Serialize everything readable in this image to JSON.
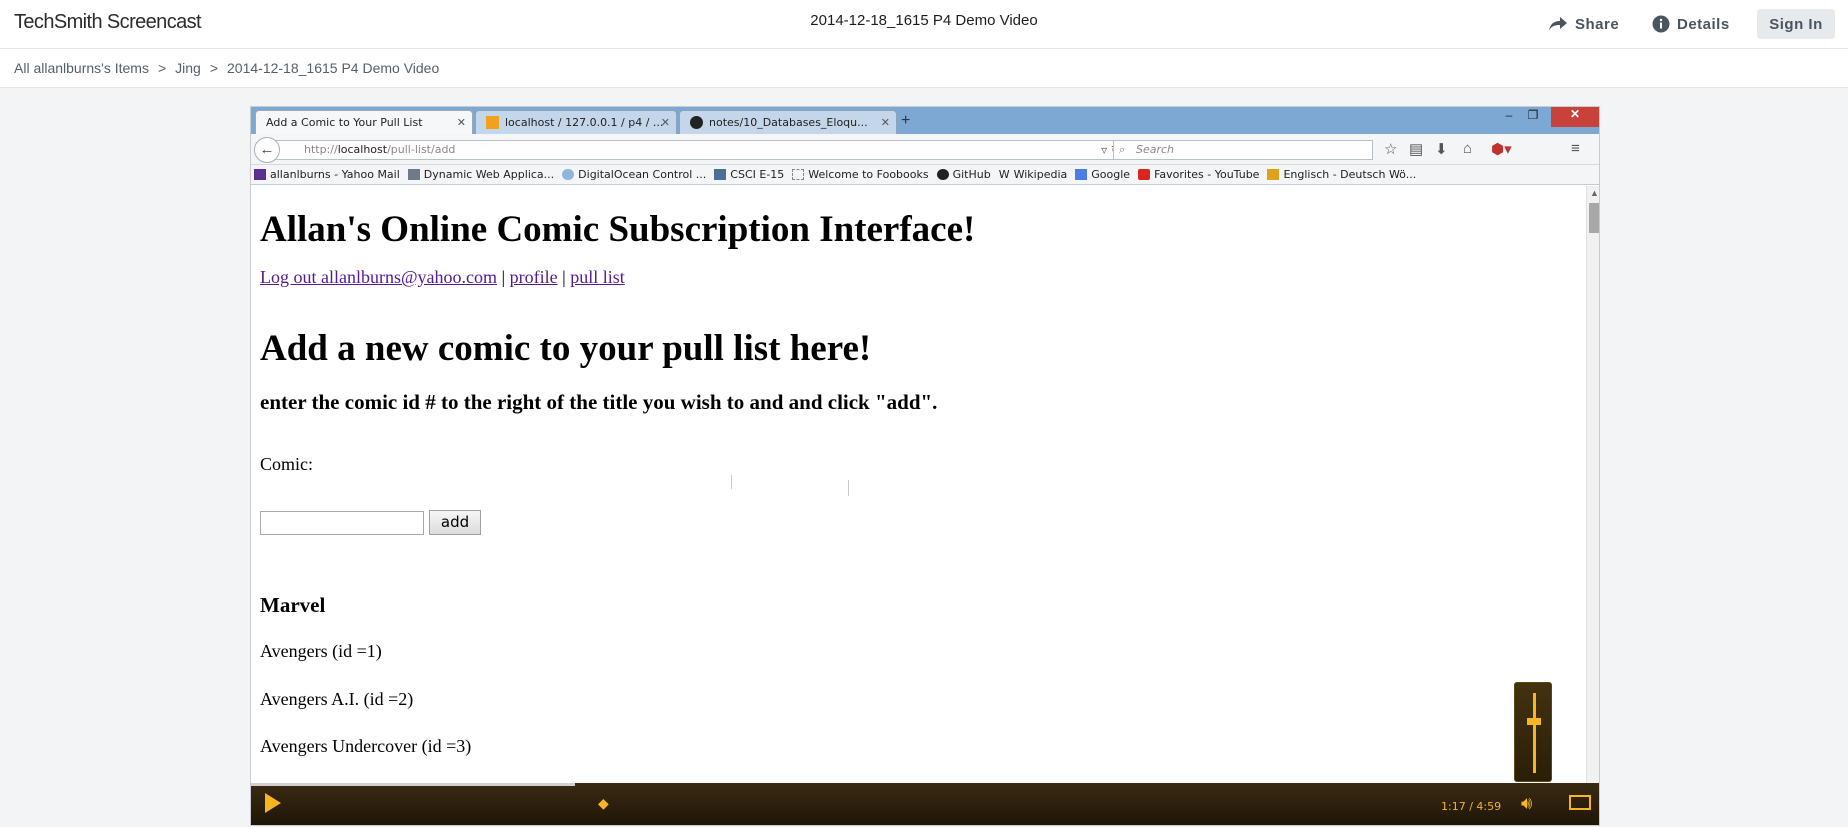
{
  "app": {
    "logo": "TechSmith Screencast",
    "title": "2014-12-18_1615 P4 Demo Video",
    "share_label": "Share",
    "details_label": "Details",
    "signin_label": "Sign In"
  },
  "breadcrumb": {
    "items": [
      "All allanlburns's Items",
      "Jing",
      "2014-12-18_1615 P4 Demo Video"
    ],
    "separator": ">"
  },
  "browser": {
    "tabs": [
      {
        "label": "Add a Comic to Your Pull List",
        "active": true
      },
      {
        "label": "localhost / 127.0.0.1 / p4 / ...",
        "active": false
      },
      {
        "label": "notes/10_Databases_Eloqu...",
        "active": false
      }
    ],
    "url_prefix": "http://",
    "url_host": "localhost",
    "url_path": "/pull-list/add",
    "search_placeholder": "Search",
    "bookmarks": [
      "allanlburns - Yahoo Mail",
      "Dynamic Web Applica...",
      "DigitalOcean Control ...",
      "CSCI E-15",
      "Welcome to Foobooks",
      "GitHub",
      "Wikipedia",
      "Google",
      "Favorites - YouTube",
      "Englisch - Deutsch Wö..."
    ]
  },
  "webpage": {
    "heading": "Allan's Online Comic Subscription Interface!",
    "logout_link": "Log out allanlburns@yahoo.com",
    "link_sep": "|",
    "profile_link": "profile",
    "pull_list_link": "pull list",
    "subheading": "Add a new comic to your pull list here!",
    "instruction": "enter the comic id # to the right of the title you wish to and and click \"add\".",
    "comic_label": "Comic:",
    "add_button": "add",
    "publisher": "Marvel",
    "comics": [
      "Avengers (id =1)",
      "Avengers A.I. (id =2)",
      "Avengers Undercover (id =3)"
    ]
  },
  "player": {
    "time": "1:17 / 4:59",
    "progress": 0.257,
    "volume_level": 0.65,
    "accent_color": "#f7b423"
  }
}
